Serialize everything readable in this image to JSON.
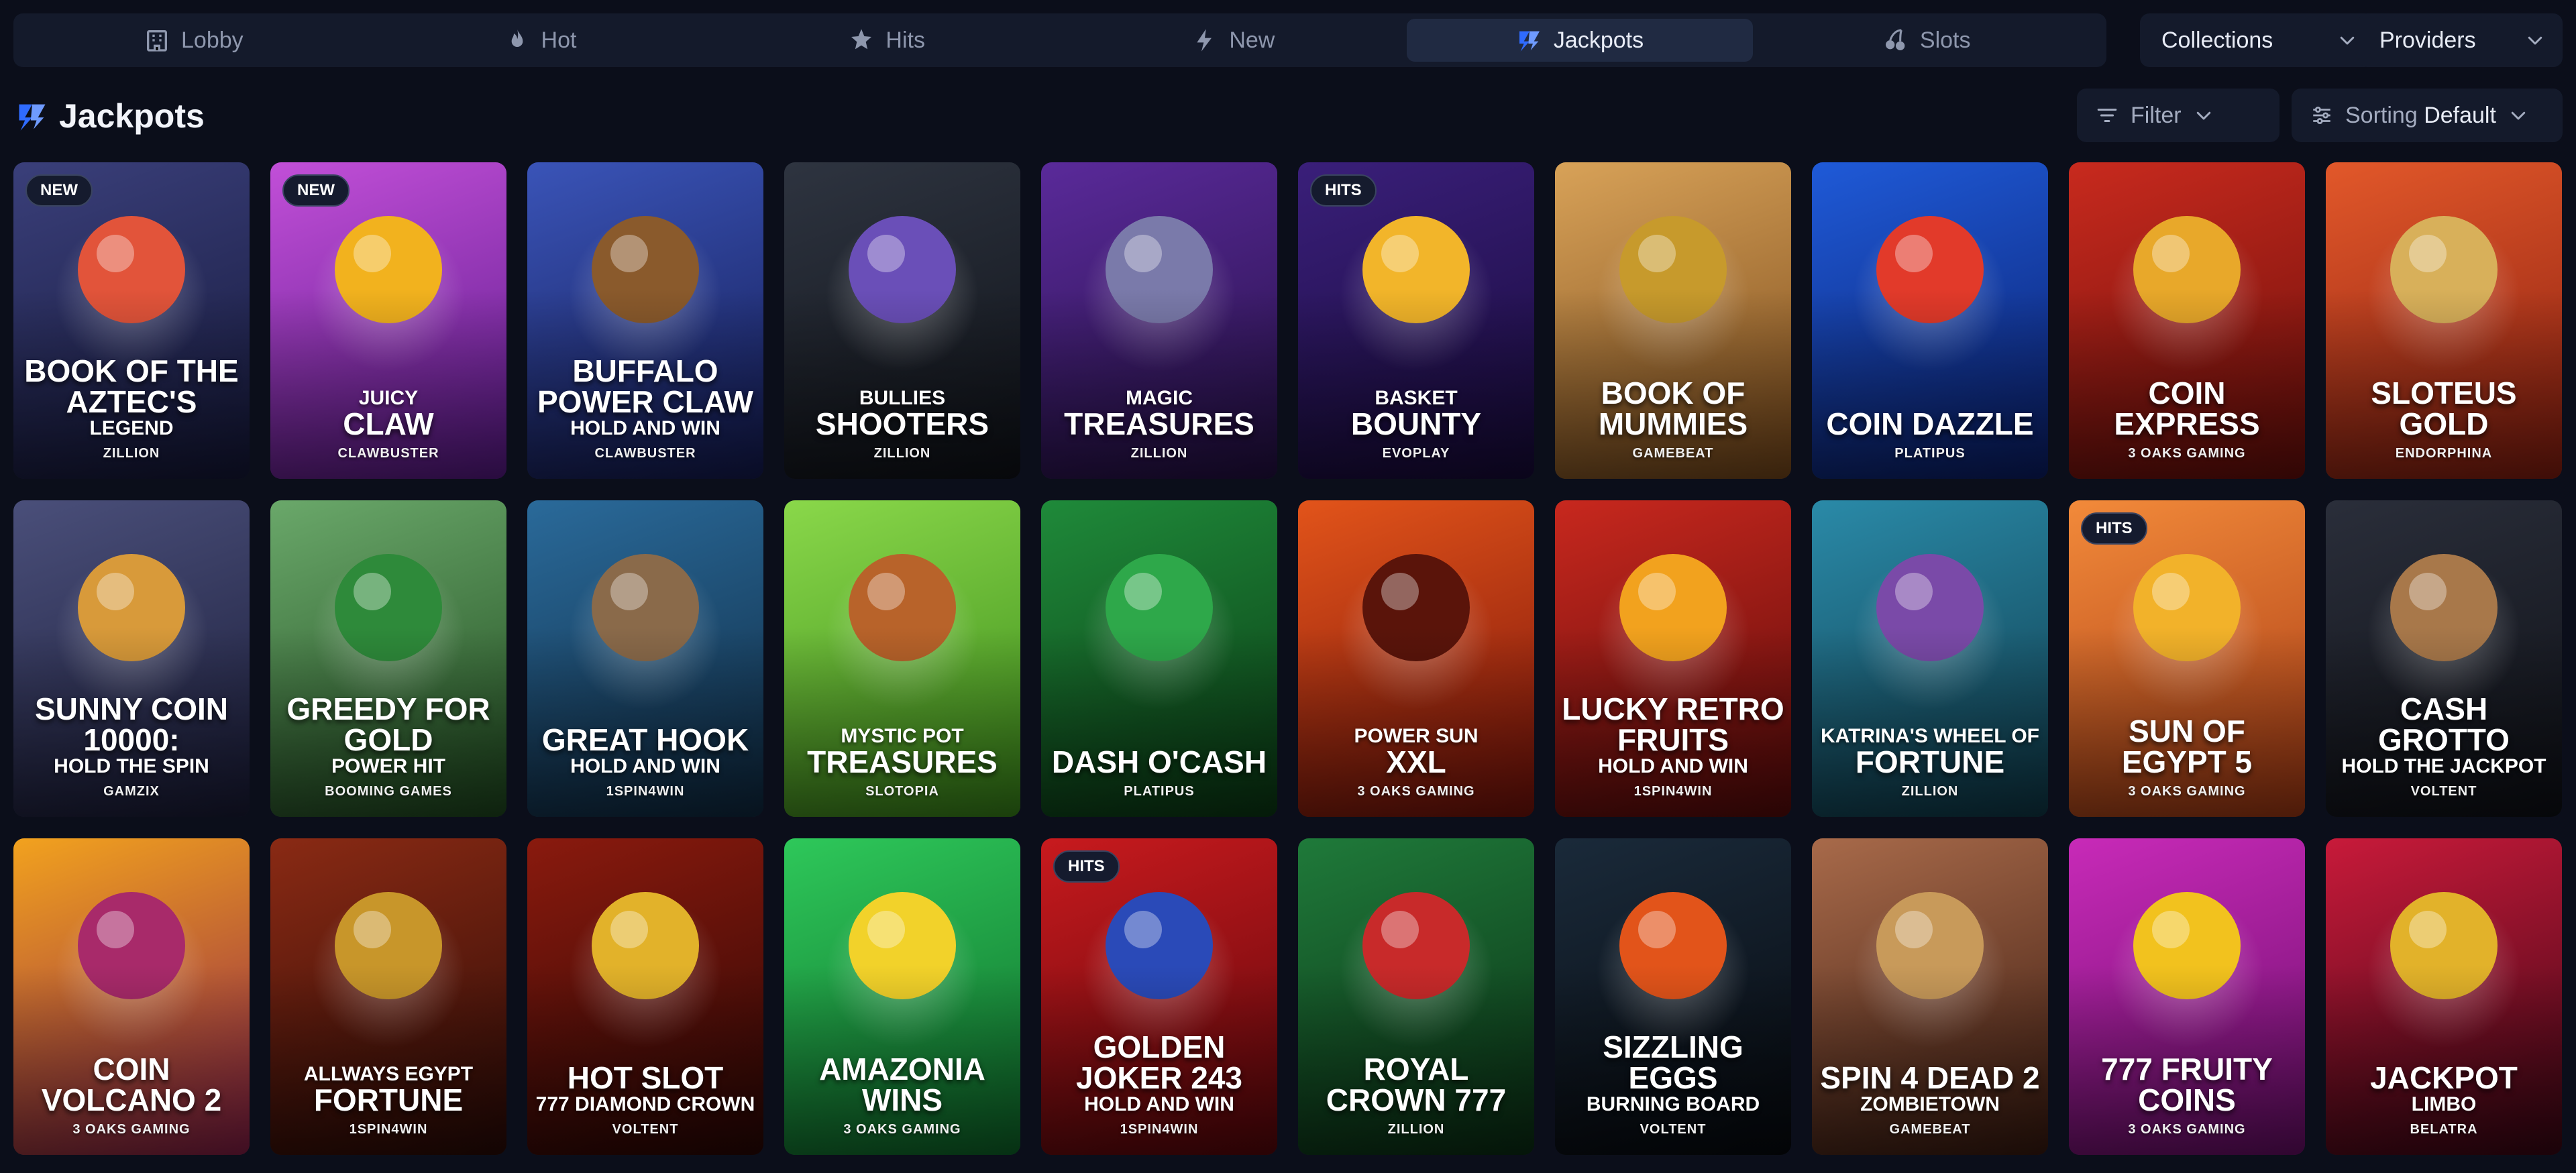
{
  "tabs": [
    {
      "label": "Lobby",
      "icon": "building-icon",
      "active": false
    },
    {
      "label": "Hot",
      "icon": "flame-icon",
      "active": false
    },
    {
      "label": "Hits",
      "icon": "star-burst-icon",
      "active": false
    },
    {
      "label": "New",
      "icon": "new-bolt-icon",
      "active": false
    },
    {
      "label": "Jackpots",
      "icon": "jackpot-icon",
      "active": true
    },
    {
      "label": "Slots",
      "icon": "cherries-icon",
      "active": false
    }
  ],
  "collections_label": "Collections",
  "providers_label": "Providers",
  "section": {
    "title": "Jackpots",
    "icon": "jackpot-icon"
  },
  "filter_label": "Filter",
  "sorting": {
    "label": "Sorting",
    "value": "Default"
  },
  "colors": {
    "accent": "#2f6bff",
    "background": "#0b0e1a",
    "panel": "#141a2b"
  },
  "games": [
    {
      "small": "",
      "big": "BOOK OF THE AZTEC'S",
      "sub": "LEGEND",
      "provider": "ZILLION",
      "badge": "NEW",
      "bg1": "#3a3f7a",
      "bg2": "#15183a",
      "art": "#e2543a"
    },
    {
      "small": "JUICY",
      "big": "CLAW",
      "sub": "",
      "provider": "CLAWBUSTER",
      "badge": "NEW",
      "bg1": "#c24fd8",
      "bg2": "#5a1a8a",
      "art": "#f2b21e"
    },
    {
      "small": "",
      "big": "BUFFALO POWER CLAW",
      "sub": "HOLD AND WIN",
      "provider": "CLAWBUSTER",
      "badge": "",
      "bg1": "#3a54b8",
      "bg2": "#141b52",
      "art": "#8a5a2c"
    },
    {
      "small": "BULLIES",
      "big": "SHOOTERS",
      "sub": "",
      "provider": "ZILLION",
      "badge": "",
      "bg1": "#2e3440",
      "bg2": "#0f1218",
      "art": "#6a4fb8"
    },
    {
      "small": "MAGIC",
      "big": "TREASURES",
      "sub": "",
      "provider": "ZILLION",
      "badge": "",
      "bg1": "#5a2a9a",
      "bg2": "#241045",
      "art": "#7a7aaa"
    },
    {
      "small": "BASKET",
      "big": "BOUNTY",
      "sub": "",
      "provider": "EVOPLAY",
      "badge": "HITS",
      "bg1": "#3a1f7a",
      "bg2": "#170a3a",
      "art": "#f2b52a"
    },
    {
      "small": "",
      "big": "BOOK OF MUMMIES",
      "sub": "",
      "provider": "GAMEBEAT",
      "badge": "",
      "bg1": "#d8a258",
      "bg2": "#7a4a1c",
      "art": "#c79a2c"
    },
    {
      "small": "",
      "big": "COIN DAZZLE",
      "sub": "",
      "provider": "PLATIPUS",
      "badge": "",
      "bg1": "#1f5ad8",
      "bg2": "#0a1e6a",
      "art": "#e23a2a"
    },
    {
      "small": "",
      "big": "COIN EXPRESS",
      "sub": "",
      "provider": "3 OAKS GAMING",
      "badge": "",
      "bg1": "#c82a1e",
      "bg2": "#6a0e0a",
      "art": "#e8a82a"
    },
    {
      "small": "",
      "big": "SLOTEUS GOLD",
      "sub": "",
      "provider": "ENDORPHINA",
      "badge": "",
      "bg1": "#e2582a",
      "bg2": "#8a1e10",
      "art": "#d8b05a"
    },
    {
      "small": "",
      "big": "SUNNY COIN 10000:",
      "sub": "HOLD THE SPIN",
      "provider": "GAMZIX",
      "badge": "",
      "bg1": "#4a4f7a",
      "bg2": "#1a1c38",
      "art": "#d89a3a"
    },
    {
      "small": "",
      "big": "GREEDY FOR GOLD",
      "sub": "POWER HIT",
      "provider": "BOOMING GAMES",
      "badge": "",
      "bg1": "#6aa86a",
      "bg2": "#1f4a1f",
      "art": "#2e8a3a"
    },
    {
      "small": "",
      "big": "GREAT HOOK",
      "sub": "HOLD AND WIN",
      "provider": "1SPIN4WIN",
      "badge": "",
      "bg1": "#2a6a9a",
      "bg2": "#0f2a42",
      "art": "#8a6a4a"
    },
    {
      "small": "MYSTIC POT",
      "big": "TREASURES",
      "sub": "",
      "provider": "SLOTOPIA",
      "badge": "",
      "bg1": "#8ad84a",
      "bg2": "#3a8a1a",
      "art": "#b8632a"
    },
    {
      "small": "",
      "big": "DASH O'CASH",
      "sub": "",
      "provider": "PLATIPUS",
      "badge": "",
      "bg1": "#1f8a3a",
      "bg2": "#0a3a14",
      "art": "#2ea84a"
    },
    {
      "small": "POWER SUN",
      "big": "XXL",
      "sub": "",
      "provider": "3 OAKS GAMING",
      "badge": "",
      "bg1": "#e2541a",
      "bg2": "#7a120a",
      "art": "#5a140a"
    },
    {
      "small": "",
      "big": "LUCKY RETRO FRUITS",
      "sub": "HOLD AND WIN",
      "provider": "1SPIN4WIN",
      "badge": "",
      "bg1": "#c8281e",
      "bg2": "#5a0a0a",
      "art": "#f2a21e"
    },
    {
      "small": "KATRINA'S WHEEL OF",
      "big": "FORTUNE",
      "sub": "",
      "provider": "ZILLION",
      "badge": "",
      "bg1": "#2a8aa8",
      "bg2": "#0f3a4a",
      "art": "#7a4aa8"
    },
    {
      "small": "",
      "big": "SUN OF EGYPT 5",
      "sub": "",
      "provider": "3 OAKS GAMING",
      "badge": "HITS",
      "bg1": "#f28a3a",
      "bg2": "#a83a14",
      "art": "#f2b22a"
    },
    {
      "small": "",
      "big": "CASH GROTTO",
      "sub": "HOLD THE JACKPOT",
      "provider": "VOLTENT",
      "badge": "",
      "bg1": "#2a2e3a",
      "bg2": "#0e1016",
      "art": "#a8784a"
    },
    {
      "small": "",
      "big": "COIN VOLCANO 2",
      "sub": "",
      "provider": "3 OAKS GAMING",
      "badge": "",
      "bg1": "#f2a21e",
      "bg2": "#8a1e4a",
      "art": "#a82a6a"
    },
    {
      "small": "ALLWAYS EGYPT",
      "big": "FORTUNE",
      "sub": "",
      "provider": "1SPIN4WIN",
      "badge": "",
      "bg1": "#8a2a14",
      "bg2": "#2a0a06",
      "art": "#c8962a"
    },
    {
      "small": "",
      "big": "HOT SLOT",
      "sub": "777 DIAMOND CROWN",
      "provider": "VOLTENT",
      "badge": "",
      "bg1": "#8a1a0e",
      "bg2": "#2a0604",
      "art": "#e2b22a"
    },
    {
      "small": "",
      "big": "AMAZONIA WINS",
      "sub": "",
      "provider": "3 OAKS GAMING",
      "badge": "",
      "bg1": "#2ec85a",
      "bg2": "#0e6a2a",
      "art": "#f2d22a"
    },
    {
      "small": "",
      "big": "GOLDEN JOKER 243",
      "sub": "HOLD AND WIN",
      "provider": "1SPIN4WIN",
      "badge": "HITS",
      "bg1": "#c81a1e",
      "bg2": "#5a060a",
      "art": "#2a4ab8"
    },
    {
      "small": "",
      "big": "ROYAL CROWN 777",
      "sub": "",
      "provider": "ZILLION",
      "badge": "",
      "bg1": "#1f7a3a",
      "bg2": "#0a2e14",
      "art": "#c82a2a"
    },
    {
      "small": "",
      "big": "SIZZLING EGGS",
      "sub": "BURNING BOARD",
      "provider": "VOLTENT",
      "badge": "",
      "bg1": "#1a2a3a",
      "bg2": "#06090e",
      "art": "#e2541a"
    },
    {
      "small": "",
      "big": "SPIN 4 DEAD 2",
      "sub": "ZOMBIETOWN",
      "provider": "GAMEBEAT",
      "badge": "",
      "bg1": "#a86a4a",
      "bg2": "#3a1a10",
      "art": "#c89a5a"
    },
    {
      "small": "",
      "big": "777 FRUITY COINS",
      "sub": "",
      "provider": "3 OAKS GAMING",
      "badge": "",
      "bg1": "#c82ab8",
      "bg2": "#6a0e6a",
      "art": "#f2c21e"
    },
    {
      "small": "",
      "big": "JACKPOT",
      "sub": "LIMBO",
      "provider": "BELATRA",
      "badge": "",
      "bg1": "#c81a3a",
      "bg2": "#3a0614",
      "art": "#e2b22a"
    }
  ]
}
